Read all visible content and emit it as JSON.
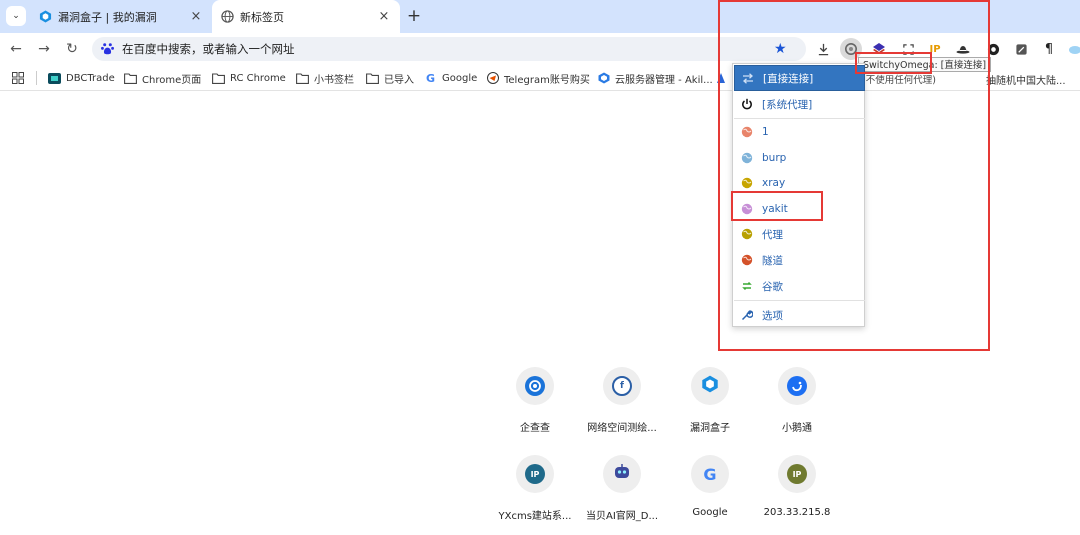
{
  "tabs": [
    {
      "title": "漏洞盒子 | 我的漏洞",
      "icon": "hexagon-shield-icon"
    },
    {
      "title": "新标签页",
      "icon": "globe-icon"
    }
  ],
  "toolbar": {
    "omnibox_placeholder": "在百度中搜索，或者输入一个网址"
  },
  "bookmarks": [
    {
      "label": "DBCTrade",
      "icon": "dbc-logo-icon"
    },
    {
      "label": "Chrome页面",
      "icon": "folder-icon"
    },
    {
      "label": "RC Chrome",
      "icon": "folder-icon"
    },
    {
      "label": "小书签栏",
      "icon": "folder-icon"
    },
    {
      "label": "已导入",
      "icon": "folder-icon"
    },
    {
      "label": "Google",
      "icon": "google-g-icon"
    },
    {
      "label": "Telegram账号购买",
      "icon": "telegram-icon"
    },
    {
      "label": "云服务器管理 - Akil...",
      "icon": "cube-icon"
    }
  ],
  "bookmark_overflow_tail": "抽随机中国大陆...",
  "proxy_menu": {
    "items": [
      {
        "label": "[直接连接]",
        "icon": "transfer-arrows-icon",
        "selected": true,
        "color": "#ffffff"
      },
      {
        "label": "[系统代理]",
        "icon": "power-icon",
        "selected": false,
        "color": "#111111"
      },
      {
        "label": "1",
        "icon": "globe-icon",
        "selected": false,
        "color": "#e8846a"
      },
      {
        "label": "burp",
        "icon": "globe-icon",
        "selected": false,
        "color": "#7fb3d9"
      },
      {
        "label": "xray",
        "icon": "globe-icon",
        "selected": false,
        "color": "#c7a500"
      },
      {
        "label": "yakit",
        "icon": "globe-icon",
        "selected": false,
        "color": "#c78fd6"
      },
      {
        "label": "代理",
        "icon": "globe-icon",
        "selected": false,
        "color": "#b8a000"
      },
      {
        "label": "隧道",
        "icon": "globe-icon",
        "selected": false,
        "color": "#d4522a"
      },
      {
        "label": "谷歌",
        "icon": "switch-rule-icon",
        "selected": false,
        "color": "#3aaa35"
      },
      {
        "label": "选项",
        "icon": "wrench-icon",
        "selected": false,
        "color": "#2a64b0"
      }
    ]
  },
  "tooltip": {
    "title": "SwitchyOmega: [直接连接]",
    "subtitle": "(不使用任何代理)"
  },
  "shortcuts": [
    {
      "label": "企查查",
      "icon": "qichacha-icon",
      "color": "#1a73d9"
    },
    {
      "label": "网络空间测绘...",
      "icon": "fofa-icon",
      "color": "#2b5fa6"
    },
    {
      "label": "漏洞盒子",
      "icon": "hexagon-shield-icon",
      "color": "#1a8fe0"
    },
    {
      "label": "小鹅通",
      "icon": "xiaoe-icon",
      "color": "#1d6ff2"
    },
    {
      "label": "YXcms建站系...",
      "icon": "ip-badge-icon",
      "color": "#1f6a8a"
    },
    {
      "label": "当贝AI官网_D...",
      "icon": "robot-icon",
      "color": "#3d4a9c"
    },
    {
      "label": "Google",
      "icon": "google-g-icon",
      "color": "#4285f4"
    },
    {
      "label": "203.33.215.8",
      "icon": "ip-badge-icon",
      "color": "#6f7a2f"
    }
  ],
  "colors": {
    "tabstrip": "#d3e3fd",
    "menu_selected": "#3375c0",
    "annotation_red": "#e53935",
    "link_blue": "#2a64b0"
  }
}
